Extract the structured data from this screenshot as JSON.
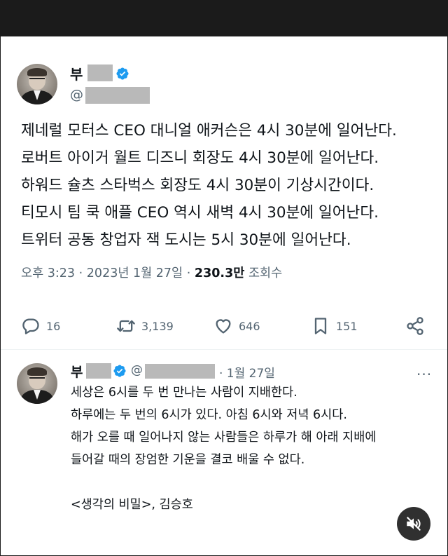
{
  "tweet": {
    "name_visible": "부",
    "handle_prefix": "@",
    "lines": [
      "제네럴 모터스 CEO 대니얼 애커슨은 4시 30분에 일어난다.",
      "로버트 아이거 월트 디즈니 회장도 4시 30분에 일어난다.",
      "하워드 슐츠 스타벅스 회장도 4시 30분이 기상시간이다.",
      "티모시 팀 쿡 애플 CEO 역시 새벽 4시 30분에 일어난다.",
      "트위터 공동 창업자 잭 도시는 5시 30분에 일어난다."
    ],
    "time": "오후 3:23",
    "separator": "·",
    "date": "2023년 1월 27일",
    "views_count": "230.3만",
    "views_label": "조회수",
    "replies": "16",
    "retweets": "3,139",
    "likes": "646",
    "bookmarks": "151"
  },
  "reply": {
    "name_visible": "부",
    "handle_prefix": "@",
    "date": "· 1월 27일",
    "more": "···",
    "lines": [
      "세상은 6시를 두 번 만나는 사람이 지배한다.",
      "하루에는 두 번의 6시가 있다. 아침 6시와 저녁 6시다.",
      "해가 오를 때 일어나지 않는 사람들은 하루가 해 아래 지배에",
      "들어갈 때의 장엄한 기운을 결코 배울 수 없다.",
      "",
      "<생각의 비밀>, 김승호"
    ]
  },
  "icons": {
    "verified": "verified-badge-icon",
    "reply": "comment-icon",
    "retweet": "retweet-icon",
    "like": "heart-icon",
    "bookmark": "bookmark-icon",
    "share": "share-icon",
    "mute": "speaker-muted-icon"
  },
  "colors": {
    "verified_blue": "#1d9bf0",
    "secondary_text": "#536471",
    "primary_text": "#0f1419",
    "redaction": "#b9b9b9"
  }
}
